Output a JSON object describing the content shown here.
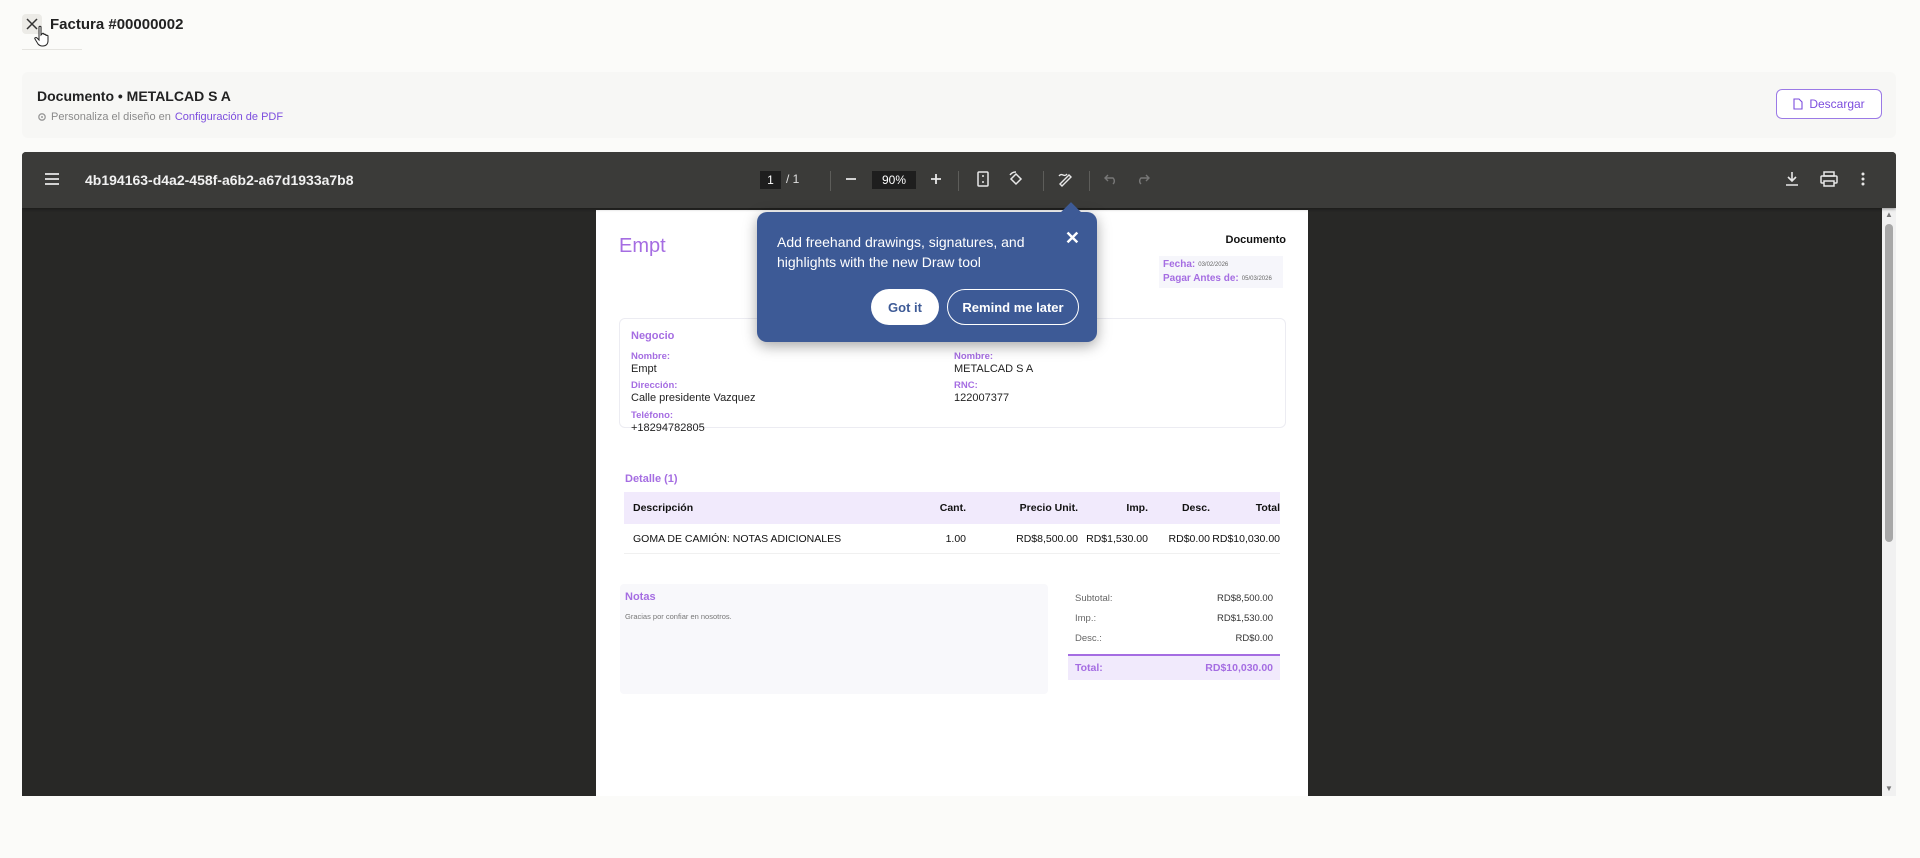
{
  "header": {
    "title": "Factura #00000002"
  },
  "doc_card": {
    "title": "Documento • METALCAD S A",
    "subtitle_prefix": "Personaliza el diseño en",
    "subtitle_link": "Configuración de PDF",
    "download_label": "Descargar"
  },
  "viewer": {
    "file_name": "4b194163-d4a2-458f-a6b2-a67d1933a7b8",
    "current_page": "1",
    "page_total": "/  1",
    "zoom": "90%",
    "icons": [
      "menu-icon",
      "zoom-out-icon",
      "zoom-in-icon",
      "fit-page-icon",
      "rotate-icon",
      "draw-icon",
      "undo-icon",
      "redo-icon",
      "download-icon",
      "print-icon",
      "more-options-icon"
    ]
  },
  "tooltip": {
    "text": "Add freehand drawings, signatures, and highlights with the new Draw tool",
    "got_it": "Got it",
    "remind": "Remind me later"
  },
  "invoice": {
    "brand": "Empt",
    "doc_label": "Documento",
    "fecha_label": "Fecha:",
    "fecha_value": "03/02/2026",
    "pagar_label": "Pagar Antes de:",
    "pagar_value": "05/03/2026",
    "business": {
      "title": "Negocio",
      "nombre_label": "Nombre:",
      "nombre": "Empt",
      "direccion_label": "Dirección:",
      "direccion": "Calle presidente Vazquez",
      "telefono_label": "Teléfono:",
      "telefono": "+18294782805"
    },
    "client": {
      "nombre_label": "Nombre:",
      "nombre": "METALCAD S A",
      "rnc_label": "RNC:",
      "rnc": "122007377"
    },
    "detail_title": "Detalle (1)",
    "columns": [
      "Descripción",
      "Cant.",
      "Precio Unit.",
      "Imp.",
      "Desc.",
      "Total"
    ],
    "rows": [
      [
        "GOMA DE CAMIÓN: NOTAS ADICIONALES",
        "1.00",
        "RD$8,500.00",
        "RD$1,530.00",
        "RD$0.00",
        "RD$10,030.00"
      ]
    ],
    "notes_title": "Notas",
    "notes_text": "Gracias por confiar en nosotros.",
    "totals": {
      "subtotal_label": "Subtotal:",
      "subtotal": "RD$8,500.00",
      "imp_label": "Imp.:",
      "imp": "RD$1,530.00",
      "desc_label": "Desc.:",
      "desc": "RD$0.00",
      "total_label": "Total:",
      "total": "RD$10,030.00"
    }
  },
  "colors": {
    "accent": "#a56de2",
    "link": "#7c4dde",
    "tooltip_bg": "#3d5a96",
    "viewer_bg": "#282826",
    "toolbar_bg": "#3b3b39"
  }
}
